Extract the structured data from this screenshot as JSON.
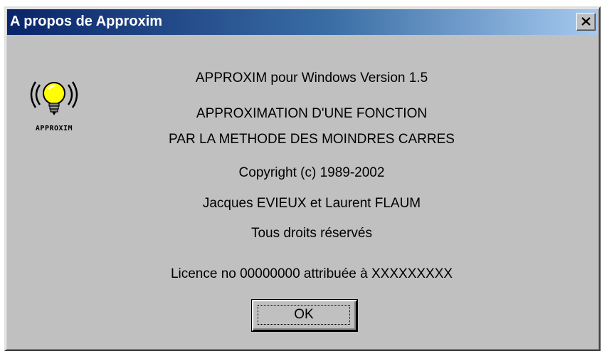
{
  "window": {
    "title": "A propos de Approxim",
    "close_icon": "close-x-icon"
  },
  "app_icon": {
    "icon": "lightbulb-icon",
    "label": "APPROXIM"
  },
  "content": {
    "product_line": "APPROXIM pour Windows Version 1.5",
    "description_line1": "APPROXIMATION D'UNE FONCTION",
    "description_line2": "PAR LA METHODE DES MOINDRES CARRES",
    "copyright": "Copyright (c) 1989-2002",
    "authors": "Jacques EVIEUX et Laurent FLAUM",
    "rights": "Tous droits réservés",
    "licence": "Licence no 00000000 attribuée à XXXXXXXXX"
  },
  "buttons": {
    "ok_label": "OK"
  },
  "colors": {
    "titlebar_start": "#0a246a",
    "titlebar_end": "#a6caf0",
    "dialog_bg": "#c0c0c0",
    "bulb": "#ffff00"
  }
}
